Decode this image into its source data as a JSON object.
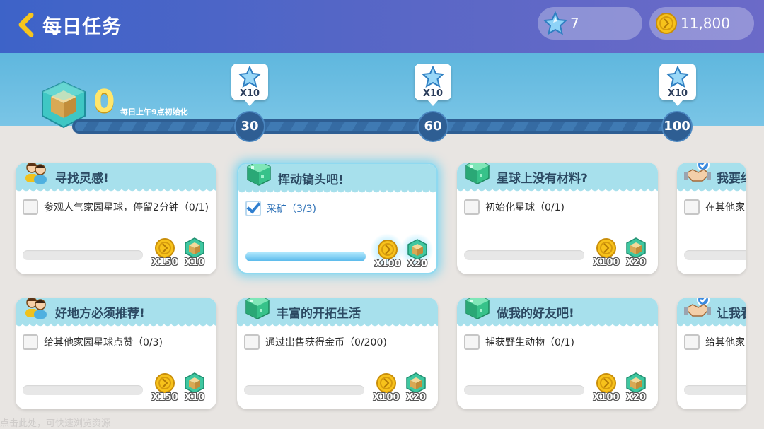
{
  "header": {
    "title": "每日任务",
    "gems": "7",
    "coins": "11,800"
  },
  "activity": {
    "score": "0",
    "reset_note": "每日上午9点初始化",
    "milestones": [
      {
        "value": "30",
        "reward_qty": "X10"
      },
      {
        "value": "60",
        "reward_qty": "X10"
      },
      {
        "value": "100",
        "reward_qty": "X10"
      }
    ]
  },
  "cards": [
    {
      "title": "寻找灵感!",
      "icon": "people-icon",
      "task": "参观人气家园星球，停留2分钟（0/1)",
      "checked": false,
      "progress": 0,
      "coin_qty": "X150",
      "cube_qty": "X10",
      "active": false
    },
    {
      "title": "挥动镐头吧!",
      "icon": "green-cube-icon",
      "task": "采矿（3/3)",
      "checked": true,
      "progress": 1,
      "coin_qty": "X100",
      "cube_qty": "X20",
      "active": true
    },
    {
      "title": "星球上没有材料?",
      "icon": "green-cube-icon",
      "task": "初始化星球（0/1)",
      "checked": false,
      "progress": 0,
      "coin_qty": "X100",
      "cube_qty": "X20",
      "active": false
    },
    {
      "title": "我要结",
      "icon": "handshake-icon",
      "task": "在其他家",
      "checked": false,
      "progress": 0,
      "coin_qty": "",
      "cube_qty": "",
      "active": false
    },
    {
      "title": "好地方必须推荐!",
      "icon": "people-icon",
      "task": "给其他家园星球点赞（0/3)",
      "checked": false,
      "progress": 0,
      "coin_qty": "X150",
      "cube_qty": "X10",
      "active": false
    },
    {
      "title": "丰富的开拓生活",
      "icon": "green-cube-icon",
      "task": "通过出售获得金币（0/200)",
      "checked": false,
      "progress": 0,
      "coin_qty": "X100",
      "cube_qty": "X20",
      "active": false
    },
    {
      "title": "做我的好友吧!",
      "icon": "green-cube-icon",
      "task": "捕获野生动物（0/1)",
      "checked": false,
      "progress": 0,
      "coin_qty": "X100",
      "cube_qty": "X20",
      "active": false
    },
    {
      "title": "让我看",
      "icon": "handshake-icon",
      "task": "给其他家",
      "checked": false,
      "progress": 0,
      "coin_qty": "",
      "cube_qty": "",
      "active": false
    }
  ],
  "footer_hint": "点击此处，可快速浏览资源"
}
